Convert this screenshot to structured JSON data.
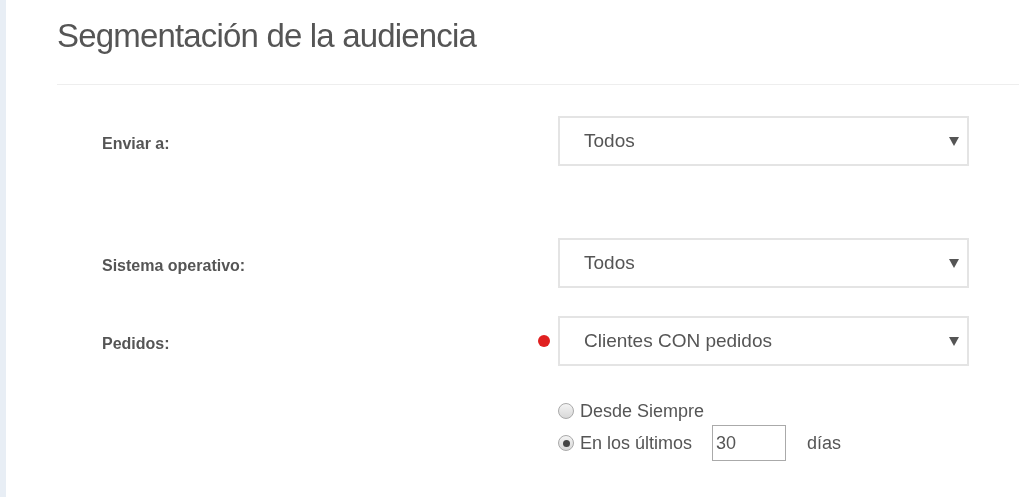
{
  "title": "Segmentación de la audiencia",
  "fields": [
    {
      "label": "Enviar a:",
      "value": "Todos"
    },
    {
      "label": "Sistema operativo:",
      "value": "Todos"
    },
    {
      "label": "Pedidos:",
      "value": "Clientes CON pedidos",
      "color": "#e02020"
    }
  ],
  "period_options": [
    {
      "kind": "plain",
      "label": "Desde Siempre",
      "selected": false
    },
    {
      "kind": "days",
      "label": "En los últimos",
      "value": "30",
      "suffix": "días",
      "selected": true
    }
  ]
}
